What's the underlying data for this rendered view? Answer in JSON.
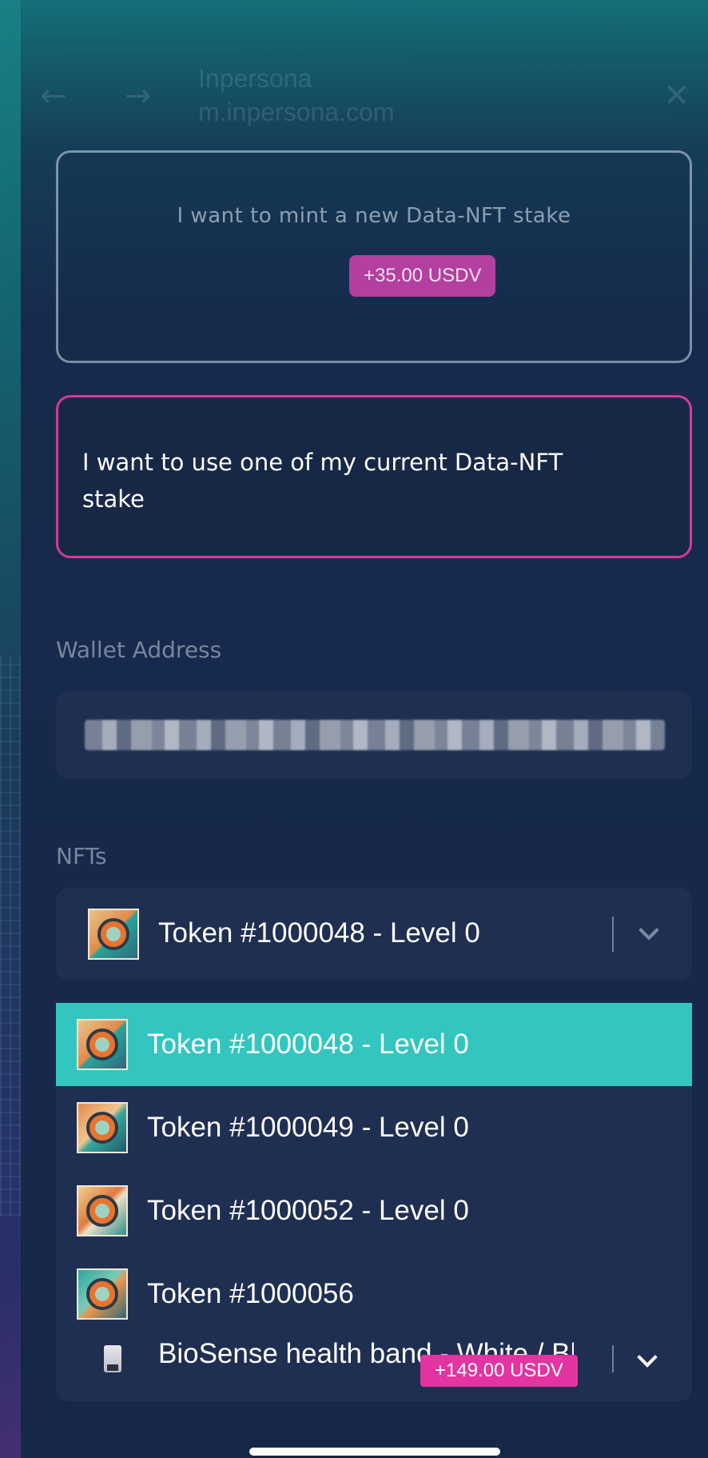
{
  "browser": {
    "site_title": "Inpersona",
    "site_url": "m.inpersona.com",
    "back_icon": "arrow-left-icon",
    "forward_icon": "arrow-right-icon",
    "close_icon": "close-icon"
  },
  "options": {
    "mint": {
      "text": "I want to mint a new Data-NFT stake",
      "badge": "+35.00 USDV"
    },
    "use_existing": {
      "text": "I want to use one of my current Data-NFT stake"
    }
  },
  "wallet": {
    "label": "Wallet Address"
  },
  "nfts": {
    "label": "NFTs",
    "selected": "Token #1000048 - Level 0",
    "dropdown": [
      {
        "label": "Token #1000048 - Level 0"
      },
      {
        "label": "Token #1000049 - Level 0"
      },
      {
        "label": "Token #1000052 - Level 0"
      },
      {
        "label": "Token #1000056"
      }
    ]
  },
  "product": {
    "name": "BioSense health band - White / Black",
    "badge": "+149.00 USDV"
  },
  "colors": {
    "accent_pink": "#d53a99",
    "selected_teal": "#33c6c0",
    "field_bg": "#1f2f52"
  }
}
